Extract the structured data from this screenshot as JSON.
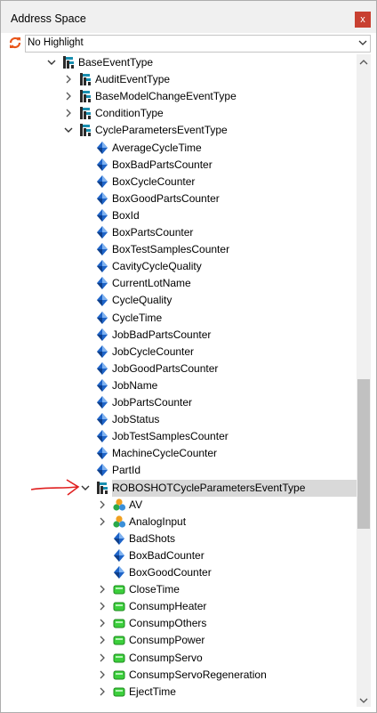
{
  "panel": {
    "title": "Address Space",
    "close_label": "x"
  },
  "toolbar": {
    "highlight_value": "No Highlight"
  },
  "colors": {
    "selection": "#d9d9d9",
    "close_button": "#c84031",
    "annotation_arrow": "#e02020"
  },
  "tree": [
    {
      "label": "BaseEventType",
      "level": 0,
      "icon": "event-type-icon",
      "expander": "expanded"
    },
    {
      "label": "AuditEventType",
      "level": 1,
      "icon": "event-type-icon",
      "expander": "collapsed"
    },
    {
      "label": "BaseModelChangeEventType",
      "level": 1,
      "icon": "event-type-icon",
      "expander": "collapsed"
    },
    {
      "label": "ConditionType",
      "level": 1,
      "icon": "event-type-icon",
      "expander": "collapsed"
    },
    {
      "label": "CycleParametersEventType",
      "level": 1,
      "icon": "event-type-icon",
      "expander": "expanded"
    },
    {
      "label": "AverageCycleTime",
      "level": 2,
      "icon": "property-icon",
      "expander": "none"
    },
    {
      "label": "BoxBadPartsCounter",
      "level": 2,
      "icon": "property-icon",
      "expander": "none"
    },
    {
      "label": "BoxCycleCounter",
      "level": 2,
      "icon": "property-icon",
      "expander": "none"
    },
    {
      "label": "BoxGoodPartsCounter",
      "level": 2,
      "icon": "property-icon",
      "expander": "none"
    },
    {
      "label": "BoxId",
      "level": 2,
      "icon": "property-icon",
      "expander": "none"
    },
    {
      "label": "BoxPartsCounter",
      "level": 2,
      "icon": "property-icon",
      "expander": "none"
    },
    {
      "label": "BoxTestSamplesCounter",
      "level": 2,
      "icon": "property-icon",
      "expander": "none"
    },
    {
      "label": "CavityCycleQuality",
      "level": 2,
      "icon": "property-icon",
      "expander": "none"
    },
    {
      "label": "CurrentLotName",
      "level": 2,
      "icon": "property-icon",
      "expander": "none"
    },
    {
      "label": "CycleQuality",
      "level": 2,
      "icon": "property-icon",
      "expander": "none"
    },
    {
      "label": "CycleTime",
      "level": 2,
      "icon": "property-icon",
      "expander": "none"
    },
    {
      "label": "JobBadPartsCounter",
      "level": 2,
      "icon": "property-icon",
      "expander": "none"
    },
    {
      "label": "JobCycleCounter",
      "level": 2,
      "icon": "property-icon",
      "expander": "none"
    },
    {
      "label": "JobGoodPartsCounter",
      "level": 2,
      "icon": "property-icon",
      "expander": "none"
    },
    {
      "label": "JobName",
      "level": 2,
      "icon": "property-icon",
      "expander": "none"
    },
    {
      "label": "JobPartsCounter",
      "level": 2,
      "icon": "property-icon",
      "expander": "none"
    },
    {
      "label": "JobStatus",
      "level": 2,
      "icon": "property-icon",
      "expander": "none"
    },
    {
      "label": "JobTestSamplesCounter",
      "level": 2,
      "icon": "property-icon",
      "expander": "none"
    },
    {
      "label": "MachineCycleCounter",
      "level": 2,
      "icon": "property-icon",
      "expander": "none"
    },
    {
      "label": "PartId",
      "level": 2,
      "icon": "property-icon",
      "expander": "none"
    },
    {
      "label": "ROBOSHOTCycleParametersEventType",
      "level": 2,
      "icon": "event-type-icon",
      "expander": "expanded",
      "selected": true
    },
    {
      "label": "AV",
      "level": 3,
      "icon": "object-cluster-icon",
      "expander": "collapsed"
    },
    {
      "label": "AnalogInput",
      "level": 3,
      "icon": "object-cluster-icon",
      "expander": "collapsed"
    },
    {
      "label": "BadShots",
      "level": 3,
      "icon": "property-icon",
      "expander": "none"
    },
    {
      "label": "BoxBadCounter",
      "level": 3,
      "icon": "property-icon",
      "expander": "none"
    },
    {
      "label": "BoxGoodCounter",
      "level": 3,
      "icon": "property-icon",
      "expander": "none"
    },
    {
      "label": "CloseTime",
      "level": 3,
      "icon": "variable-icon",
      "expander": "collapsed"
    },
    {
      "label": "ConsumpHeater",
      "level": 3,
      "icon": "variable-icon",
      "expander": "collapsed"
    },
    {
      "label": "ConsumpOthers",
      "level": 3,
      "icon": "variable-icon",
      "expander": "collapsed"
    },
    {
      "label": "ConsumpPower",
      "level": 3,
      "icon": "variable-icon",
      "expander": "collapsed"
    },
    {
      "label": "ConsumpServo",
      "level": 3,
      "icon": "variable-icon",
      "expander": "collapsed"
    },
    {
      "label": "ConsumpServoRegeneration",
      "level": 3,
      "icon": "variable-icon",
      "expander": "collapsed"
    },
    {
      "label": "EjectTime",
      "level": 3,
      "icon": "variable-icon",
      "expander": "collapsed"
    }
  ]
}
